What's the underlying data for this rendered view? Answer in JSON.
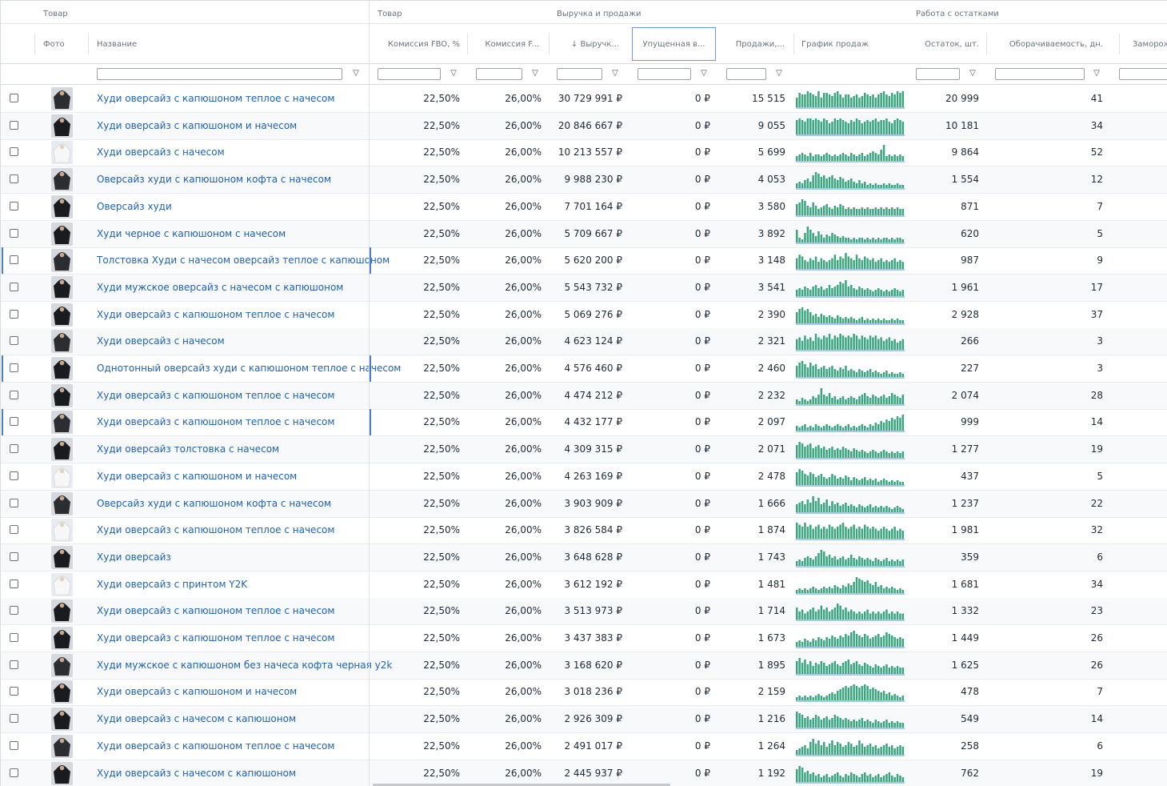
{
  "header_groups": [
    "Товар",
    "Товар",
    "Выручка и продажи",
    "Работа с остатками"
  ],
  "columns": {
    "photo": "Фото",
    "name": "Название",
    "commission_fbo": "Комиссия FBO, %",
    "commission_fbs": "Комиссия F...",
    "revenue": "↓ Выручк...",
    "lost": "Упущенная в...",
    "sales": "Продажи,...",
    "chart": "График продаж",
    "stock": "Остаток, шт.",
    "turnover": "Оборачиваемость, дн.",
    "frozen": "Заморож"
  },
  "colors": {
    "accent_link": "#1c62b9",
    "spark": "#3aa57f",
    "selection": "#4a7fd0"
  },
  "rows": [
    {
      "name": "Худи оверсайз с капюшоном теплое с начесом",
      "fbo": "22,50%",
      "fbs": "26,00%",
      "revenue": "30 729 991 ₽",
      "lost": "0 ₽",
      "sales": "15 515",
      "stock": "20 999",
      "turnover": "41",
      "selected": false,
      "spark": [
        6,
        9,
        8,
        8,
        10,
        9,
        8,
        7,
        10,
        6,
        9,
        9,
        8,
        7,
        9,
        10,
        8,
        6,
        8,
        8,
        6,
        7,
        8,
        6,
        7,
        9,
        8,
        7,
        8,
        6,
        8,
        9,
        10,
        8,
        7,
        9,
        8,
        10,
        9,
        10
      ]
    },
    {
      "name": "Худи оверсайз с капюшоном и начесом",
      "fbo": "22,50%",
      "fbs": "26,00%",
      "revenue": "20 846 667 ₽",
      "lost": "0 ₽",
      "sales": "9 055",
      "stock": "10 181",
      "turnover": "34",
      "selected": false,
      "spark": [
        9,
        10,
        9,
        8,
        10,
        10,
        9,
        10,
        9,
        8,
        10,
        9,
        7,
        8,
        10,
        9,
        10,
        9,
        8,
        7,
        9,
        8,
        10,
        9,
        7,
        8,
        9,
        8,
        9,
        10,
        8,
        9,
        9,
        10,
        8,
        7,
        9,
        10,
        9,
        8
      ]
    },
    {
      "name": "Худи оверсайз с начесом",
      "fbo": "22,50%",
      "fbs": "26,00%",
      "revenue": "10 213 557 ₽",
      "lost": "0 ₽",
      "sales": "5 699",
      "stock": "9 864",
      "turnover": "52",
      "selected": false,
      "spark": [
        3,
        4,
        5,
        4,
        3,
        5,
        3,
        4,
        4,
        3,
        4,
        5,
        4,
        3,
        4,
        3,
        4,
        5,
        4,
        3,
        5,
        4,
        3,
        4,
        5,
        3,
        4,
        5,
        6,
        5,
        4,
        7,
        10,
        3,
        4,
        3,
        4,
        3,
        4,
        3
      ]
    },
    {
      "name": "Оверсайз худи с капюшоном кофта с начесом",
      "fbo": "22,50%",
      "fbs": "26,00%",
      "revenue": "9 988 230 ₽",
      "lost": "0 ₽",
      "sales": "4 053",
      "stock": "1 554",
      "turnover": "12",
      "selected": false,
      "spark": [
        3,
        4,
        3,
        5,
        6,
        4,
        8,
        10,
        9,
        7,
        8,
        6,
        7,
        8,
        6,
        5,
        7,
        6,
        4,
        5,
        6,
        4,
        3,
        5,
        3,
        4,
        2,
        3,
        2,
        3,
        2,
        2,
        3,
        2,
        3,
        2,
        2,
        3,
        2,
        2
      ]
    },
    {
      "name": "Оверсайз худи",
      "fbo": "22,50%",
      "fbs": "26,00%",
      "revenue": "7 701 164 ₽",
      "lost": "0 ₽",
      "sales": "3 580",
      "stock": "871",
      "turnover": "7",
      "selected": false,
      "spark": [
        7,
        8,
        10,
        9,
        6,
        5,
        8,
        6,
        4,
        5,
        6,
        7,
        5,
        4,
        6,
        5,
        7,
        6,
        4,
        5,
        4,
        5,
        4,
        4,
        5,
        4,
        5,
        4,
        4,
        5,
        4,
        5,
        4,
        5,
        4,
        5,
        4,
        5,
        4,
        4
      ]
    },
    {
      "name": "Худи черное с капюшоном с начесом",
      "fbo": "22,50%",
      "fbs": "26,00%",
      "revenue": "5 709 667 ₽",
      "lost": "0 ₽",
      "sales": "3 892",
      "stock": "620",
      "turnover": "5",
      "selected": false,
      "spark": [
        8,
        3,
        2,
        6,
        10,
        8,
        6,
        4,
        7,
        5,
        3,
        5,
        4,
        6,
        5,
        4,
        3,
        4,
        3,
        3,
        2,
        3,
        2,
        3,
        3,
        2,
        3,
        2,
        3,
        2,
        3,
        2,
        3,
        3,
        2,
        3,
        2,
        3,
        3,
        2
      ]
    },
    {
      "name": "Толстовка Худи с начесом оверсайз теплое с капюшоном",
      "fbo": "22,50%",
      "fbs": "26,00%",
      "revenue": "5 620 200 ₽",
      "lost": "0 ₽",
      "sales": "3 148",
      "stock": "987",
      "turnover": "9",
      "selected": true,
      "spark": [
        6,
        8,
        7,
        5,
        4,
        6,
        5,
        7,
        4,
        6,
        5,
        4,
        5,
        6,
        8,
        5,
        7,
        6,
        9,
        7,
        6,
        5,
        8,
        6,
        5,
        7,
        6,
        5,
        6,
        4,
        5,
        6,
        4,
        5,
        4,
        5,
        6,
        4,
        5,
        4
      ]
    },
    {
      "name": "Худи мужское оверсайз с начесом с капюшоном",
      "fbo": "22,50%",
      "fbs": "26,00%",
      "revenue": "5 543 732 ₽",
      "lost": "0 ₽",
      "sales": "3 541",
      "stock": "1 961",
      "turnover": "17",
      "selected": false,
      "spark": [
        4,
        5,
        4,
        6,
        5,
        4,
        6,
        7,
        5,
        6,
        4,
        5,
        7,
        5,
        6,
        7,
        9,
        8,
        10,
        6,
        7,
        5,
        4,
        6,
        5,
        4,
        5,
        4,
        3,
        4,
        5,
        4,
        3,
        4,
        3,
        4,
        5,
        4,
        3,
        4
      ]
    },
    {
      "name": "Худи оверсайз с капюшоном теплое с начесом",
      "fbo": "22,50%",
      "fbs": "26,00%",
      "revenue": "5 069 276 ₽",
      "lost": "0 ₽",
      "sales": "2 390",
      "stock": "2 928",
      "turnover": "37",
      "selected": false,
      "spark": [
        7,
        9,
        10,
        8,
        9,
        7,
        5,
        6,
        4,
        6,
        5,
        4,
        5,
        4,
        3,
        5,
        4,
        3,
        4,
        3,
        4,
        3,
        2,
        3,
        4,
        2,
        3,
        2,
        3,
        2,
        3,
        2,
        3,
        2,
        2,
        3,
        2,
        3,
        2,
        2
      ]
    },
    {
      "name": "Худи оверсайз с начесом",
      "fbo": "22,50%",
      "fbs": "26,00%",
      "revenue": "4 623 124 ₽",
      "lost": "0 ₽",
      "sales": "2 321",
      "stock": "266",
      "turnover": "3",
      "selected": false,
      "spark": [
        6,
        7,
        5,
        8,
        6,
        7,
        5,
        9,
        7,
        6,
        8,
        7,
        9,
        6,
        8,
        7,
        9,
        8,
        7,
        8,
        7,
        9,
        8,
        6,
        8,
        7,
        6,
        8,
        7,
        8,
        6,
        7,
        5,
        6,
        7,
        5,
        6,
        4,
        5,
        6
      ]
    },
    {
      "name": "Однотонный оверсайз худи с капюшоном теплое с начесом",
      "fbo": "22,50%",
      "fbs": "26,00%",
      "revenue": "4 576 460 ₽",
      "lost": "0 ₽",
      "sales": "2 460",
      "stock": "227",
      "turnover": "3",
      "selected": true,
      "spark": [
        7,
        9,
        10,
        8,
        6,
        9,
        7,
        8,
        5,
        6,
        7,
        5,
        6,
        7,
        5,
        4,
        6,
        5,
        7,
        4,
        5,
        4,
        3,
        5,
        4,
        3,
        4,
        5,
        3,
        4,
        3,
        2,
        3,
        4,
        2,
        3,
        2,
        2,
        3,
        2
      ]
    },
    {
      "name": "Худи оверсайз с капюшоном теплое с начесом",
      "fbo": "22,50%",
      "fbs": "26,00%",
      "revenue": "4 474 212 ₽",
      "lost": "0 ₽",
      "sales": "2 232",
      "stock": "2 074",
      "turnover": "28",
      "selected": false,
      "spark": [
        3,
        2,
        4,
        3,
        2,
        3,
        5,
        4,
        6,
        10,
        6,
        5,
        7,
        4,
        5,
        3,
        4,
        5,
        3,
        4,
        5,
        4,
        3,
        5,
        6,
        7,
        5,
        4,
        6,
        5,
        4,
        5,
        6,
        4,
        5,
        7,
        6,
        5,
        4,
        6
      ]
    },
    {
      "name": "Худи оверсайз с капюшоном теплое с начесом",
      "fbo": "22,50%",
      "fbs": "26,00%",
      "revenue": "4 432 177 ₽",
      "lost": "0 ₽",
      "sales": "2 097",
      "stock": "999",
      "turnover": "14",
      "selected": true,
      "spark": [
        3,
        2,
        3,
        4,
        2,
        3,
        2,
        4,
        3,
        2,
        3,
        4,
        3,
        2,
        3,
        4,
        3,
        2,
        3,
        4,
        2,
        3,
        2,
        3,
        4,
        3,
        2,
        4,
        3,
        5,
        4,
        6,
        5,
        7,
        6,
        8,
        7,
        9,
        8,
        10
      ]
    },
    {
      "name": "Худи оверсайз толстовка с начесом",
      "fbo": "22,50%",
      "fbs": "26,00%",
      "revenue": "4 309 315 ₽",
      "lost": "0 ₽",
      "sales": "2 071",
      "stock": "1 277",
      "turnover": "19",
      "selected": false,
      "spark": [
        8,
        10,
        9,
        7,
        8,
        9,
        6,
        7,
        8,
        6,
        7,
        5,
        6,
        7,
        5,
        6,
        5,
        7,
        6,
        5,
        4,
        6,
        5,
        4,
        5,
        4,
        3,
        4,
        5,
        4,
        3,
        4,
        5,
        4,
        3,
        4,
        3,
        4,
        3,
        4
      ]
    },
    {
      "name": "Худи оверсайз с капюшоном и начесом",
      "fbo": "22,50%",
      "fbs": "26,00%",
      "revenue": "4 263 169 ₽",
      "lost": "0 ₽",
      "sales": "2 478",
      "stock": "437",
      "turnover": "5",
      "selected": false,
      "spark": [
        8,
        10,
        9,
        7,
        6,
        8,
        7,
        5,
        6,
        7,
        5,
        4,
        5,
        7,
        6,
        4,
        5,
        4,
        6,
        5,
        3,
        5,
        4,
        3,
        4,
        5,
        3,
        4,
        3,
        4,
        2,
        3,
        4,
        3,
        2,
        3,
        2,
        3,
        2,
        2
      ]
    },
    {
      "name": "Оверсайз худи с капюшоном кофта с начесом",
      "fbo": "22,50%",
      "fbs": "26,00%",
      "revenue": "3 903 909 ₽",
      "lost": "0 ₽",
      "sales": "1 666",
      "stock": "1 237",
      "turnover": "22",
      "selected": false,
      "spark": [
        5,
        6,
        7,
        5,
        8,
        6,
        10,
        7,
        9,
        5,
        6,
        8,
        4,
        7,
        5,
        6,
        4,
        5,
        6,
        4,
        5,
        4,
        3,
        5,
        4,
        3,
        4,
        5,
        3,
        4,
        3,
        4,
        3,
        4,
        3,
        2,
        3,
        4,
        3,
        2
      ]
    },
    {
      "name": "Худи оверсайз с капюшоном теплое с начесом",
      "fbo": "22,50%",
      "fbs": "26,00%",
      "revenue": "3 826 584 ₽",
      "lost": "0 ₽",
      "sales": "1 874",
      "stock": "1 981",
      "turnover": "32",
      "selected": false,
      "spark": [
        8,
        7,
        6,
        8,
        6,
        7,
        5,
        6,
        7,
        5,
        6,
        5,
        7,
        6,
        5,
        6,
        7,
        8,
        6,
        5,
        6,
        7,
        5,
        6,
        5,
        7,
        6,
        5,
        6,
        5,
        4,
        5,
        6,
        5,
        4,
        5,
        6,
        4,
        5,
        4
      ]
    },
    {
      "name": "Худи оверсайз",
      "fbo": "22,50%",
      "fbs": "26,00%",
      "revenue": "3 648 628 ₽",
      "lost": "0 ₽",
      "sales": "1 743",
      "stock": "359",
      "turnover": "6",
      "selected": false,
      "spark": [
        3,
        4,
        3,
        5,
        6,
        5,
        4,
        6,
        8,
        10,
        9,
        6,
        7,
        5,
        6,
        4,
        5,
        6,
        4,
        5,
        7,
        5,
        4,
        6,
        5,
        4,
        5,
        4,
        3,
        5,
        4,
        3,
        4,
        5,
        3,
        4,
        3,
        4,
        3,
        4
      ]
    },
    {
      "name": "Худи оверсайз с принтом Y2K",
      "fbo": "22,50%",
      "fbs": "26,00%",
      "revenue": "3 612 192 ₽",
      "lost": "0 ₽",
      "sales": "1 481",
      "stock": "1 681",
      "turnover": "34",
      "selected": false,
      "spark": [
        2,
        3,
        2,
        3,
        2,
        3,
        4,
        3,
        2,
        3,
        4,
        3,
        4,
        3,
        5,
        4,
        3,
        5,
        4,
        6,
        5,
        7,
        10,
        9,
        8,
        7,
        8,
        6,
        5,
        7,
        4,
        5,
        3,
        4,
        3,
        4,
        3,
        2,
        3,
        2
      ]
    },
    {
      "name": "Худи оверсайз с капюшоном теплое с начесом",
      "fbo": "22,50%",
      "fbs": "26,00%",
      "revenue": "3 513 973 ₽",
      "lost": "0 ₽",
      "sales": "1 714",
      "stock": "1 332",
      "turnover": "23",
      "selected": false,
      "spark": [
        6,
        4,
        5,
        3,
        4,
        5,
        6,
        4,
        5,
        7,
        5,
        6,
        4,
        5,
        6,
        8,
        7,
        5,
        6,
        4,
        5,
        4,
        3,
        4,
        3,
        4,
        5,
        3,
        4,
        3,
        4,
        3,
        4,
        5,
        3,
        4,
        3,
        4,
        3,
        3
      ]
    },
    {
      "name": "Худи оверсайз с капюшоном теплое с начесом",
      "fbo": "22,50%",
      "fbs": "26,00%",
      "revenue": "3 437 383 ₽",
      "lost": "0 ₽",
      "sales": "1 673",
      "stock": "1 449",
      "turnover": "26",
      "selected": false,
      "spark": [
        3,
        4,
        3,
        5,
        4,
        3,
        5,
        4,
        6,
        5,
        4,
        6,
        5,
        7,
        6,
        5,
        7,
        6,
        8,
        7,
        9,
        10,
        8,
        7,
        6,
        8,
        7,
        5,
        6,
        7,
        8,
        6,
        7,
        9,
        8,
        7,
        6,
        5,
        6,
        5
      ]
    },
    {
      "name": "Худи мужское с капюшоном без начеса кофта черная y2k",
      "fbo": "22,50%",
      "fbs": "26,00%",
      "revenue": "3 168 620 ₽",
      "lost": "0 ₽",
      "sales": "1 895",
      "stock": "1 625",
      "turnover": "26",
      "selected": false,
      "spark": [
        8,
        10,
        7,
        9,
        6,
        8,
        5,
        7,
        6,
        8,
        7,
        5,
        6,
        7,
        8,
        6,
        5,
        7,
        8,
        9,
        6,
        7,
        8,
        6,
        5,
        7,
        6,
        5,
        4,
        6,
        5,
        4,
        5,
        6,
        4,
        5,
        4,
        5,
        4,
        4
      ]
    },
    {
      "name": "Худи оверсайз с капюшоном и начесом",
      "fbo": "22,50%",
      "fbs": "26,00%",
      "revenue": "3 018 236 ₽",
      "lost": "0 ₽",
      "sales": "2 159",
      "stock": "478",
      "turnover": "7",
      "selected": false,
      "spark": [
        2,
        3,
        2,
        3,
        2,
        3,
        2,
        3,
        4,
        3,
        2,
        3,
        4,
        5,
        4,
        6,
        7,
        8,
        9,
        8,
        9,
        10,
        9,
        8,
        9,
        10,
        9,
        7,
        8,
        7,
        6,
        5,
        6,
        4,
        5,
        3,
        4,
        3,
        2,
        3
      ]
    },
    {
      "name": "Худи оверсайз с начесом с капюшоном",
      "fbo": "22,50%",
      "fbs": "26,00%",
      "revenue": "2 926 309 ₽",
      "lost": "0 ₽",
      "sales": "1 216",
      "stock": "549",
      "turnover": "14",
      "selected": false,
      "spark": [
        10,
        9,
        8,
        6,
        7,
        5,
        6,
        8,
        7,
        5,
        6,
        7,
        5,
        6,
        8,
        7,
        6,
        5,
        6,
        5,
        4,
        5,
        4,
        5,
        6,
        4,
        5,
        4,
        3,
        5,
        4,
        3,
        4,
        5,
        3,
        4,
        3,
        4,
        3,
        3
      ]
    },
    {
      "name": "Худи оверсайз с капюшоном теплое с начесом",
      "fbo": "22,50%",
      "fbs": "26,00%",
      "revenue": "2 491 017 ₽",
      "lost": "0 ₽",
      "sales": "1 264",
      "stock": "258",
      "turnover": "6",
      "selected": false,
      "spark": [
        3,
        4,
        5,
        6,
        4,
        8,
        10,
        7,
        9,
        6,
        8,
        5,
        7,
        9,
        6,
        8,
        7,
        5,
        6,
        8,
        7,
        5,
        6,
        9,
        7,
        5,
        6,
        7,
        5,
        6,
        4,
        5,
        6,
        7,
        5,
        6,
        4,
        5,
        6,
        5
      ]
    },
    {
      "name": "Худи оверсайз с начесом с капюшоном",
      "fbo": "22,50%",
      "fbs": "26,00%",
      "revenue": "2 445 937 ₽",
      "lost": "0 ₽",
      "sales": "1 192",
      "stock": "762",
      "turnover": "19",
      "selected": false,
      "spark": [
        8,
        10,
        9,
        6,
        7,
        5,
        6,
        4,
        5,
        3,
        4,
        5,
        3,
        4,
        5,
        6,
        4,
        3,
        5,
        4,
        6,
        5,
        4,
        3,
        5,
        6,
        4,
        5,
        3,
        4,
        5,
        3,
        4,
        5,
        6,
        4,
        3,
        5,
        4,
        3
      ]
    }
  ]
}
